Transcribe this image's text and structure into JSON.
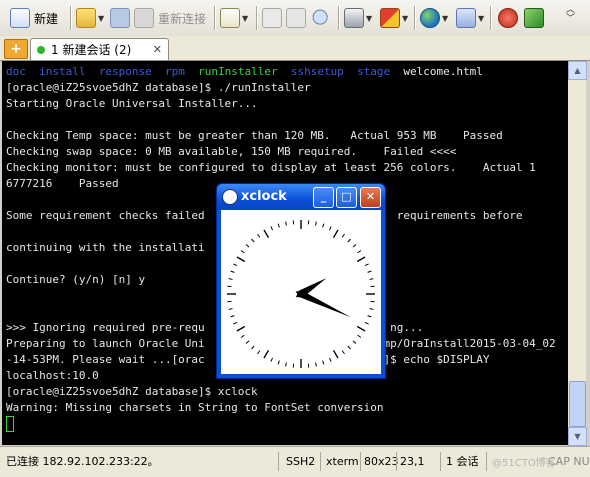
{
  "toolbar": {
    "new_label": "新建",
    "reconnect_label": "重新连接"
  },
  "tab": {
    "add_label": "+",
    "label": "1 新建会话 (2)",
    "close_label": "✕"
  },
  "terminal": {
    "lines": [
      {
        "segments": [
          {
            "t": "doc",
            "c": "blue"
          },
          {
            "t": "  "
          },
          {
            "t": "install",
            "c": "blue"
          },
          {
            "t": "  "
          },
          {
            "t": "response",
            "c": "blue"
          },
          {
            "t": "  "
          },
          {
            "t": "rpm",
            "c": "blue"
          },
          {
            "t": "  "
          },
          {
            "t": "runInstaller",
            "c": "green"
          },
          {
            "t": "  "
          },
          {
            "t": "sshsetup",
            "c": "blue"
          },
          {
            "t": "  "
          },
          {
            "t": "stage",
            "c": "blue"
          },
          {
            "t": "  welcome.html"
          }
        ]
      },
      {
        "segments": [
          {
            "t": "[oracle@iZ25svoe5dhZ database]$ ./runInstaller"
          }
        ]
      },
      {
        "segments": [
          {
            "t": "Starting Oracle Universal Installer..."
          }
        ]
      },
      {
        "segments": [
          {
            "t": ""
          }
        ]
      },
      {
        "segments": [
          {
            "t": "Checking Temp space: must be greater than 120 MB.   Actual 953 MB    Passed"
          }
        ]
      },
      {
        "segments": [
          {
            "t": "Checking swap space: 0 MB available, 150 MB required.    Failed <<<<"
          }
        ]
      },
      {
        "segments": [
          {
            "t": "Checking monitor: must be configured to display at least 256 colors.    Actual 1"
          }
        ]
      },
      {
        "segments": [
          {
            "t": "6777216    Passed"
          }
        ]
      },
      {
        "segments": [
          {
            "t": ""
          }
        ]
      },
      {
        "segments": [
          {
            "t": "Some requirement checks failed                             requirements before"
          }
        ]
      },
      {
        "segments": [
          {
            "t": ""
          }
        ]
      },
      {
        "segments": [
          {
            "t": "continuing with the installati"
          }
        ]
      },
      {
        "segments": [
          {
            "t": ""
          }
        ]
      },
      {
        "segments": [
          {
            "t": "Continue? (y/n) [n] y"
          }
        ]
      },
      {
        "segments": [
          {
            "t": ""
          }
        ]
      },
      {
        "segments": [
          {
            "t": ""
          }
        ]
      },
      {
        "segments": [
          {
            "t": ">>> Ignoring required pre-requ                            ng..."
          }
        ]
      },
      {
        "segments": [
          {
            "t": "Preparing to launch Oracle Uni                           mp/OraInstall2015-03-04_02"
          }
        ]
      },
      {
        "segments": [
          {
            "t": "-14-53PM. Please wait ...[orac                           ]$ echo $DISPLAY"
          }
        ]
      },
      {
        "segments": [
          {
            "t": "localhost:10.0"
          }
        ]
      },
      {
        "segments": [
          {
            "t": "[oracle@iZ25svoe5dhZ database]$ xclock"
          }
        ]
      },
      {
        "segments": [
          {
            "t": "Warning: Missing charsets in String to FontSet conversion"
          }
        ]
      }
    ]
  },
  "status": {
    "connection": "已连接 182.92.102.233:22。",
    "protocol": "SSH2",
    "term": "xterm",
    "size": "80x23",
    "position": "23,1",
    "sessions": "1 会话",
    "indicators": "CAP NUM",
    "watermark": "@51CTO博客"
  },
  "xclock": {
    "title": "xclock",
    "min_label": "_",
    "max_label": "□",
    "close_label": "✕"
  },
  "colors": {
    "terminal_bg": "#000000",
    "dir_blue": "#3b59d6",
    "exec_green": "#36d236",
    "xp_title_blue": "#0a4fd8"
  }
}
